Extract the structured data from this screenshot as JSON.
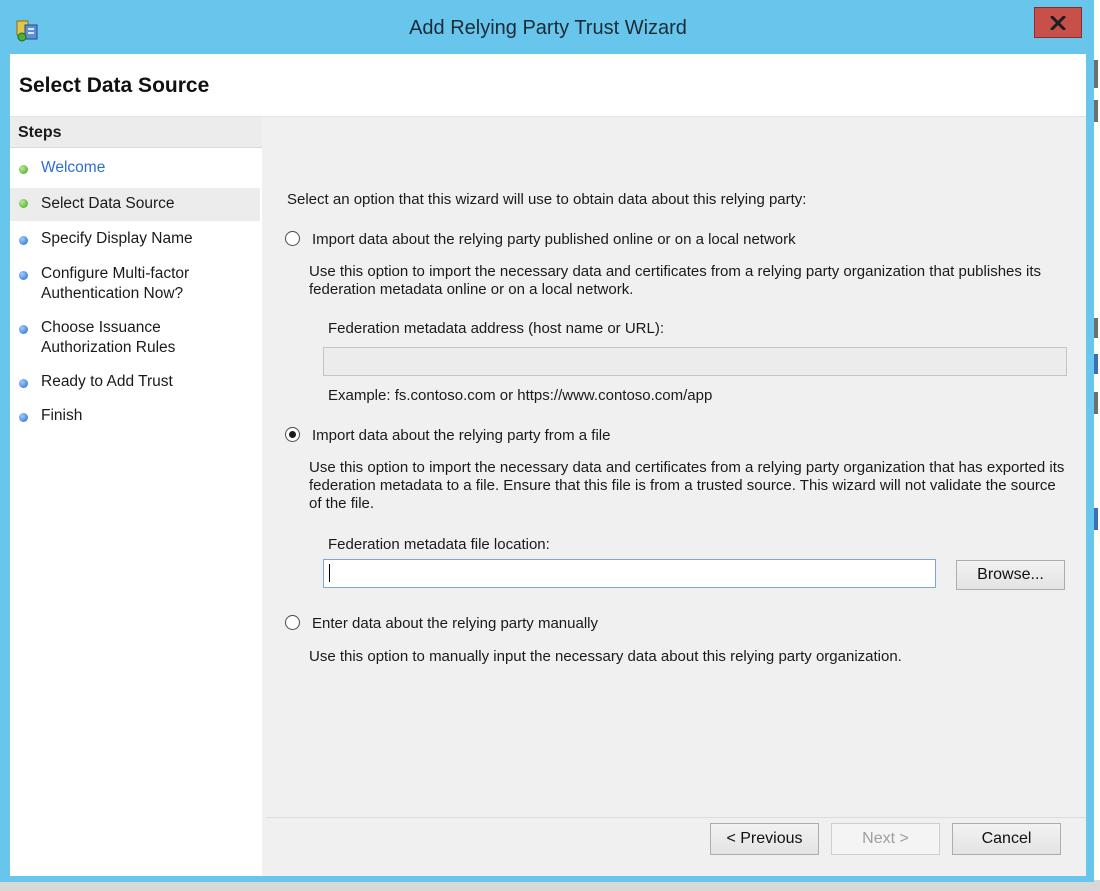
{
  "window": {
    "title": "Add Relying Party Trust Wizard"
  },
  "page": {
    "title": "Select Data Source"
  },
  "steps": {
    "header": "Steps",
    "items": [
      {
        "label": "Welcome",
        "status": "completed",
        "color": "#3ca31c"
      },
      {
        "label": "Select Data Source",
        "status": "current",
        "color": "#3ca31c"
      },
      {
        "label": "Specify Display Name",
        "status": "pending",
        "color": "#2066d0"
      },
      {
        "label": "Configure Multi-factor Authentication Now?",
        "status": "pending",
        "color": "#2066d0"
      },
      {
        "label": "Choose Issuance Authorization Rules",
        "status": "pending",
        "color": "#2066d0"
      },
      {
        "label": "Ready to Add Trust",
        "status": "pending",
        "color": "#2066d0"
      },
      {
        "label": "Finish",
        "status": "pending",
        "color": "#2066d0"
      }
    ]
  },
  "content": {
    "intro": "Select an option that this wizard will use to obtain data about this relying party:",
    "options": {
      "online": {
        "label": "Import data about the relying party published online or on a local network",
        "selected": false,
        "description": "Use this option to import the necessary data and certificates from a relying party organization that publishes its federation metadata online or on a local network.",
        "field_label": "Federation metadata address (host name or URL):",
        "field_value": "",
        "example": "Example: fs.contoso.com or https://www.contoso.com/app"
      },
      "file": {
        "label": "Import data about the relying party from a file",
        "selected": true,
        "description": "Use this option to import the necessary data and certificates from a relying party organization that has exported its federation metadata to a file. Ensure that this file is from a trusted source.  This wizard will not validate the source of the file.",
        "field_label": "Federation metadata file location:",
        "field_value": "",
        "browse_label": "Browse..."
      },
      "manual": {
        "label": "Enter data about the relying party manually",
        "selected": false,
        "description": "Use this option to manually input the necessary data about this relying party organization."
      }
    }
  },
  "buttons": {
    "previous": "< Previous",
    "next": "Next >",
    "cancel": "Cancel"
  },
  "icons": {
    "app": "relying-party-icon",
    "close": "close-icon"
  },
  "colors": {
    "title_bar": "#68c6ec",
    "close_button": "#c7504a",
    "link": "#2d6ed2"
  }
}
